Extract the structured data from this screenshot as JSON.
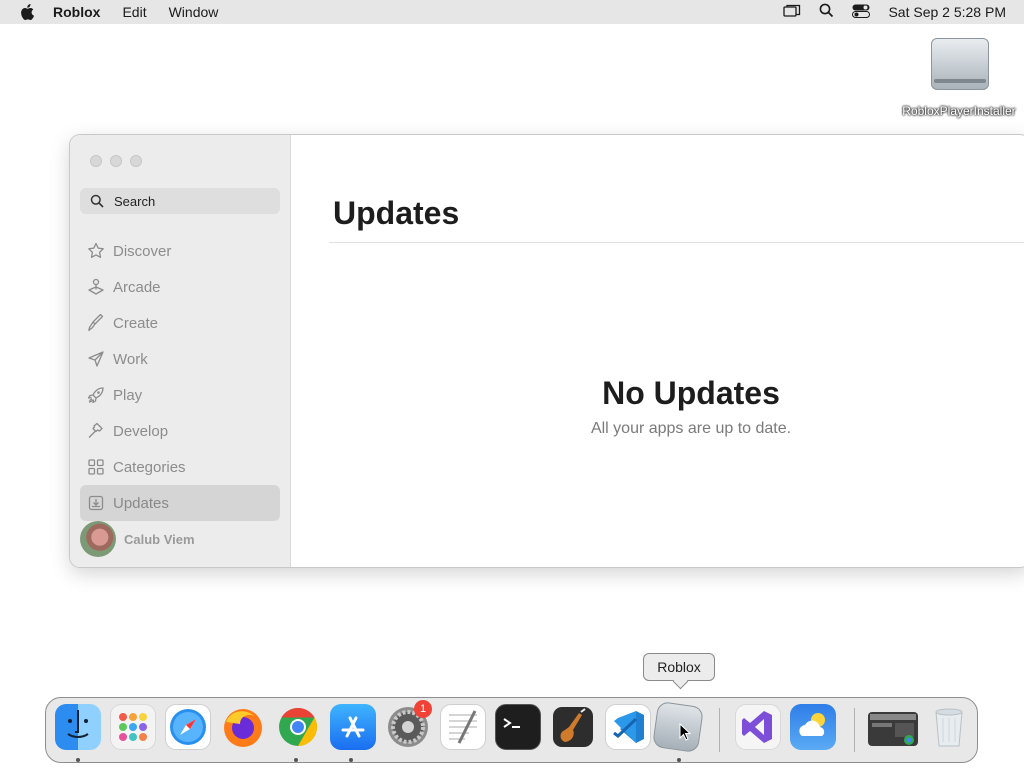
{
  "menubar": {
    "app_name": "Roblox",
    "items": [
      "Edit",
      "Window"
    ],
    "clock": "Sat Sep 2  5:28 PM"
  },
  "desktop": {
    "icon_label": "RobloxPlayerInstaller"
  },
  "window": {
    "search_placeholder": "Search",
    "nav": [
      {
        "label": "Discover",
        "icon": "star-icon"
      },
      {
        "label": "Arcade",
        "icon": "joystick-icon"
      },
      {
        "label": "Create",
        "icon": "brush-icon"
      },
      {
        "label": "Work",
        "icon": "paper-plane-icon"
      },
      {
        "label": "Play",
        "icon": "rocket-icon"
      },
      {
        "label": "Develop",
        "icon": "hammer-icon"
      },
      {
        "label": "Categories",
        "icon": "grid-icon"
      },
      {
        "label": "Updates",
        "icon": "download-tray-icon",
        "selected": true
      }
    ],
    "user_name": "Calub Viem",
    "title": "Updates",
    "empty_title": "No Updates",
    "empty_subtitle": "All your apps are up to date."
  },
  "dock": {
    "tooltip": "Roblox",
    "settings_badge": "1",
    "apps": [
      "Finder",
      "Launchpad",
      "Safari",
      "Firefox",
      "Chrome",
      "App Store",
      "System Settings",
      "TextEdit",
      "Terminal",
      "GarageBand",
      "Visual Studio Code",
      "Roblox",
      "Visual Studio",
      "Weather",
      "Recent Window",
      "Trash"
    ]
  },
  "colors": {
    "menubar": "#e6e6e6",
    "sidebar": "#ececec",
    "selected_item": "#d5d5d5",
    "badge": "#f04236"
  }
}
